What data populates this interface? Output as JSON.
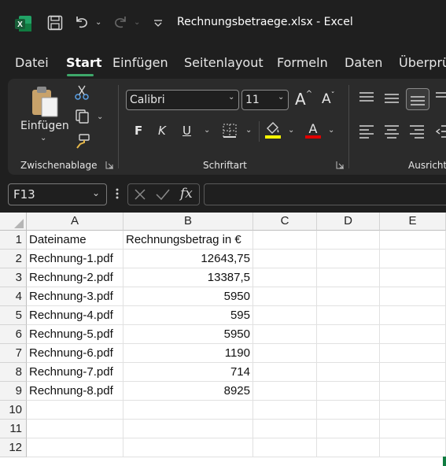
{
  "window": {
    "title": "Rechnungsbetraege.xlsx  -  Excel"
  },
  "tabs": [
    "Datei",
    "Start",
    "Einfügen",
    "Seitenlayout",
    "Formeln",
    "Daten",
    "Überprü"
  ],
  "active_tab": "Start",
  "ribbon": {
    "clipboard": {
      "paste_label": "Einfügen",
      "group_label": "Zwischenablage"
    },
    "font": {
      "font_name": "Calibri",
      "font_size": "11",
      "bold": "F",
      "italic": "K",
      "underline": "U",
      "group_label": "Schriftart",
      "fill_color": "#ffff00",
      "font_color": "#e00000"
    },
    "alignment": {
      "group_label": "Ausricht"
    }
  },
  "formula_bar": {
    "name_box": "F13",
    "fx": "fx",
    "content": ""
  },
  "sheet": {
    "columns": [
      "A",
      "B",
      "C",
      "D",
      "E"
    ],
    "rows": [
      "1",
      "2",
      "3",
      "4",
      "5",
      "6",
      "7",
      "8",
      "9",
      "10",
      "11",
      "12"
    ],
    "cells": [
      [
        "Dateiname",
        "Rechnungsbetrag in €"
      ],
      [
        "Rechnung-1.pdf",
        "12643,75"
      ],
      [
        "Rechnung-2.pdf",
        "13387,5"
      ],
      [
        "Rechnung-3.pdf",
        "5950"
      ],
      [
        "Rechnung-4.pdf",
        "595"
      ],
      [
        "Rechnung-5.pdf",
        "5950"
      ],
      [
        "Rechnung-6.pdf",
        "1190"
      ],
      [
        "Rechnung-7.pdf",
        "714"
      ],
      [
        "Rechnung-8.pdf",
        "8925"
      ]
    ]
  },
  "colors": {
    "accent": "#3ea86a",
    "excel_green": "#107c41"
  }
}
